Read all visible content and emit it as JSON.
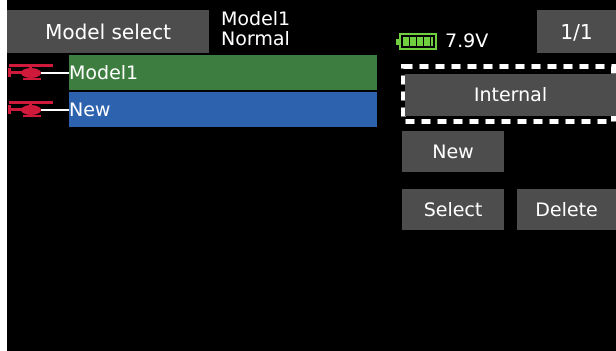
{
  "header": {
    "title": "Model select",
    "model_name": "Model1",
    "condition": "Normal",
    "battery_voltage": "7.9V",
    "page_indicator": "1/1"
  },
  "model_list": [
    {
      "label": "Model1",
      "selected": true
    },
    {
      "label": "New",
      "selected": false
    }
  ],
  "buttons": {
    "storage": "Internal",
    "new": "New",
    "select": "Select",
    "delete": "Delete"
  },
  "colors": {
    "background": "#000000",
    "button_gray": "#4d4d4d",
    "current_model_green": "#3d7d3f",
    "cursor_blue": "#2d62ae",
    "battery_green": "#6fcf3e",
    "heli_icon_red": "#d01a3c"
  },
  "icons": {
    "model_type": "helicopter-icon",
    "battery": "battery-icon"
  }
}
